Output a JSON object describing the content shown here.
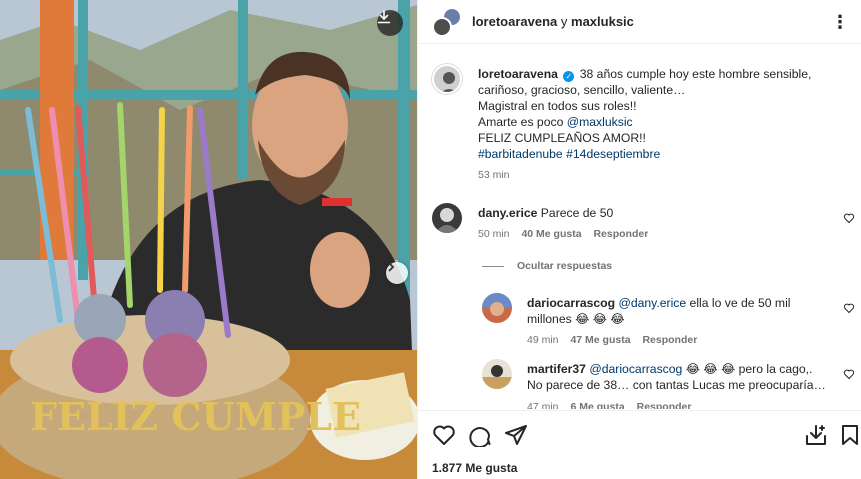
{
  "header": {
    "user1": "loretoaravena",
    "connector": "y",
    "user2": "maxluksic"
  },
  "caption": {
    "username": "loretoaravena",
    "line1": "38 años cumple hoy este hombre sensible,",
    "line2": "cariñoso, gracioso, sencillo, valiente…",
    "line3": "Magistral en todos sus roles!!",
    "line4_prefix": "Amarte es poco ",
    "mention": "@maxluksic",
    "line5": "FELIZ CUMPLEAÑOS AMOR!!",
    "hashtag1": "#barbitadenube",
    "hashtag2": "#14deseptiembre",
    "time": "53 min"
  },
  "comments": [
    {
      "username": "dany.erice",
      "text": "Parece de 50",
      "time": "50 min",
      "likes": "40 Me gusta",
      "reply": "Responder"
    }
  ],
  "hide_replies": "Ocultar respuestas",
  "replies": [
    {
      "username": "dariocarrascog",
      "mention": "@dany.erice",
      "text1": " ella lo ve de 50 mil",
      "text2": "millones 😂 😂 😂",
      "time": "49 min",
      "likes": "47 Me gusta",
      "reply": "Responder"
    },
    {
      "username": "martifer37",
      "mention": "@dariocarrascog",
      "text1": " 😂 😂 😂  pero la cago,.",
      "text2": "No parece de 38… con tantas Lucas me preocuparía…",
      "time": "47 min",
      "likes": "6 Me gusta",
      "reply": "Responder"
    }
  ],
  "likes_count": "1.877 Me gusta",
  "cake_text": "FELIZ CUMPLE",
  "colors": {
    "link": "#00376b",
    "verified": "#0095f6",
    "muted": "#737373"
  }
}
